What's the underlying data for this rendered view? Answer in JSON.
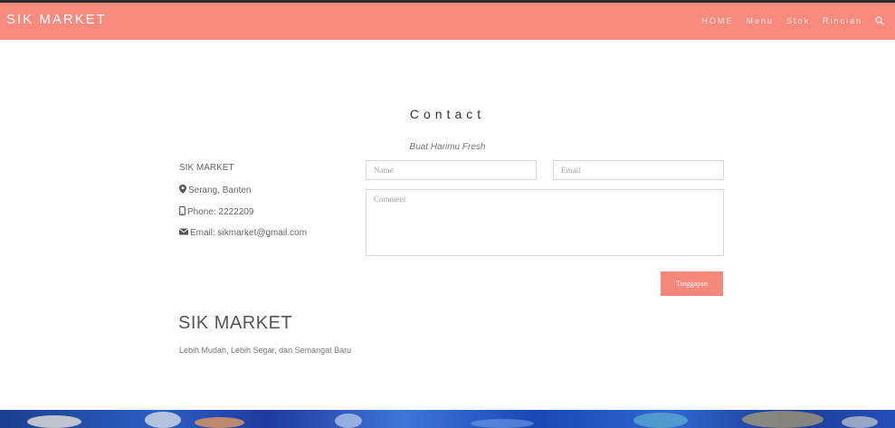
{
  "navbar": {
    "brand": "SIK MARKET",
    "items": [
      "HOME",
      "Menu",
      "Stok",
      "Rincian"
    ],
    "search_icon": "search-icon"
  },
  "contact": {
    "title": "Contact",
    "subtitle": "Buat Harimu Fresh"
  },
  "info": {
    "name": "SIK MARKET",
    "location": "Serang, Banten",
    "phone": "Phone: 2222209",
    "email": "Email: sikmarket@gmail.com",
    "icons": [
      "map-marker-icon",
      "phone-icon",
      "envelope-icon"
    ]
  },
  "form": {
    "name_placeholder": "Name",
    "email_placeholder": "Email",
    "comment_placeholder": "Comment",
    "submit_label": "Tanggapan"
  },
  "footer": {
    "brand": "SIK MARKET",
    "tagline": "Lebih Mudah, Lebih Segar, dan Semangat Baru"
  },
  "colors": {
    "accent": "#f88a7e",
    "button": "#f5877b",
    "text": "#777777"
  }
}
